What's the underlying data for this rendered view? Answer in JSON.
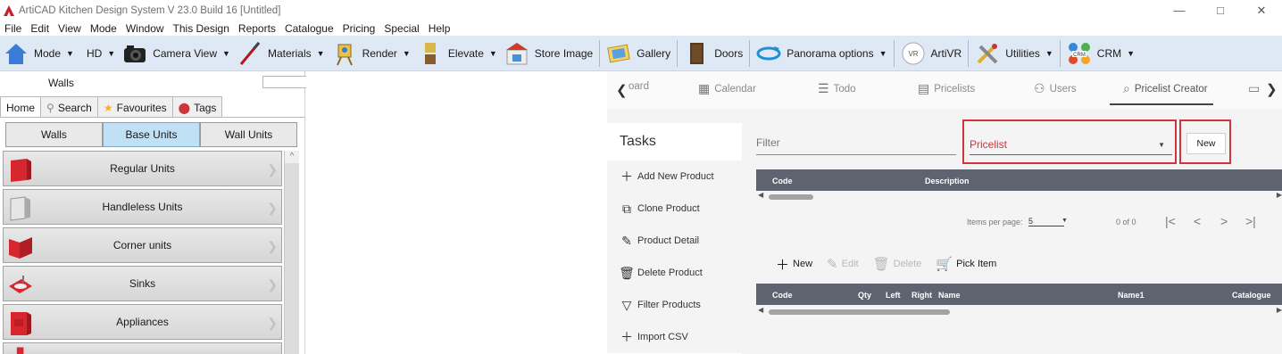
{
  "window": {
    "title": "ArtiCAD Kitchen Design System  V 23.0 Build 16   [Untitled]",
    "controls": [
      "—",
      "□",
      "✕"
    ]
  },
  "menu": [
    "File",
    "Edit",
    "View",
    "Mode",
    "Window",
    "This Design",
    "Reports",
    "Catalogue",
    "Pricing",
    "Special",
    "Help"
  ],
  "toolbar": {
    "mode": "Mode",
    "hd": "HD",
    "camera_view": "Camera View",
    "materials": "Materials",
    "render": "Render",
    "elevate": "Elevate",
    "store_image": "Store Image",
    "gallery": "Gallery",
    "doors": "Doors",
    "panorama": "Panorama options",
    "artivr": "ArtiVR",
    "vr_badge": "VR",
    "utilities": "Utilities",
    "crm": "CRM",
    "crm_badge": "CRM"
  },
  "left_panel": {
    "header_title": "Walls",
    "search_value": "",
    "tabs": [
      "Home",
      "Search",
      "Favourites",
      "Tags"
    ],
    "segments": [
      "Walls",
      "Base Units",
      "Wall Units"
    ],
    "active_segment": "Base Units",
    "categories": [
      "Regular Units",
      "Handleless Units",
      "Corner units",
      "Sinks",
      "Appliances"
    ]
  },
  "web": {
    "nav_tabs": [
      "oard",
      "Calendar",
      "Todo",
      "Pricelists",
      "Users",
      "Pricelist Creator"
    ],
    "active_tab": "Pricelist Creator",
    "tasks_title": "Tasks",
    "tasks": [
      "Add New Product",
      "Clone Product",
      "Product Detail",
      "Delete Product",
      "Filter Products",
      "Import CSV"
    ],
    "filter_label": "Filter",
    "pricelist_label": "Pricelist",
    "new_button": "New",
    "table1_columns": [
      "Code",
      "Description"
    ],
    "pager": {
      "items_per_page_label": "Items per page:",
      "items_per_page": "5",
      "range": "0 of 0"
    },
    "actions": [
      "New",
      "Edit",
      "Delete",
      "Pick Item"
    ],
    "table2_columns": [
      "Code",
      "Qty",
      "Left",
      "Right",
      "Name",
      "Name1",
      "Catalogue"
    ]
  },
  "colors": {
    "accent_red": "#d0343d",
    "toolbar_bg": "#dfe8f5",
    "table_header": "#5d6470",
    "active_segment": "#bfe0f5"
  }
}
